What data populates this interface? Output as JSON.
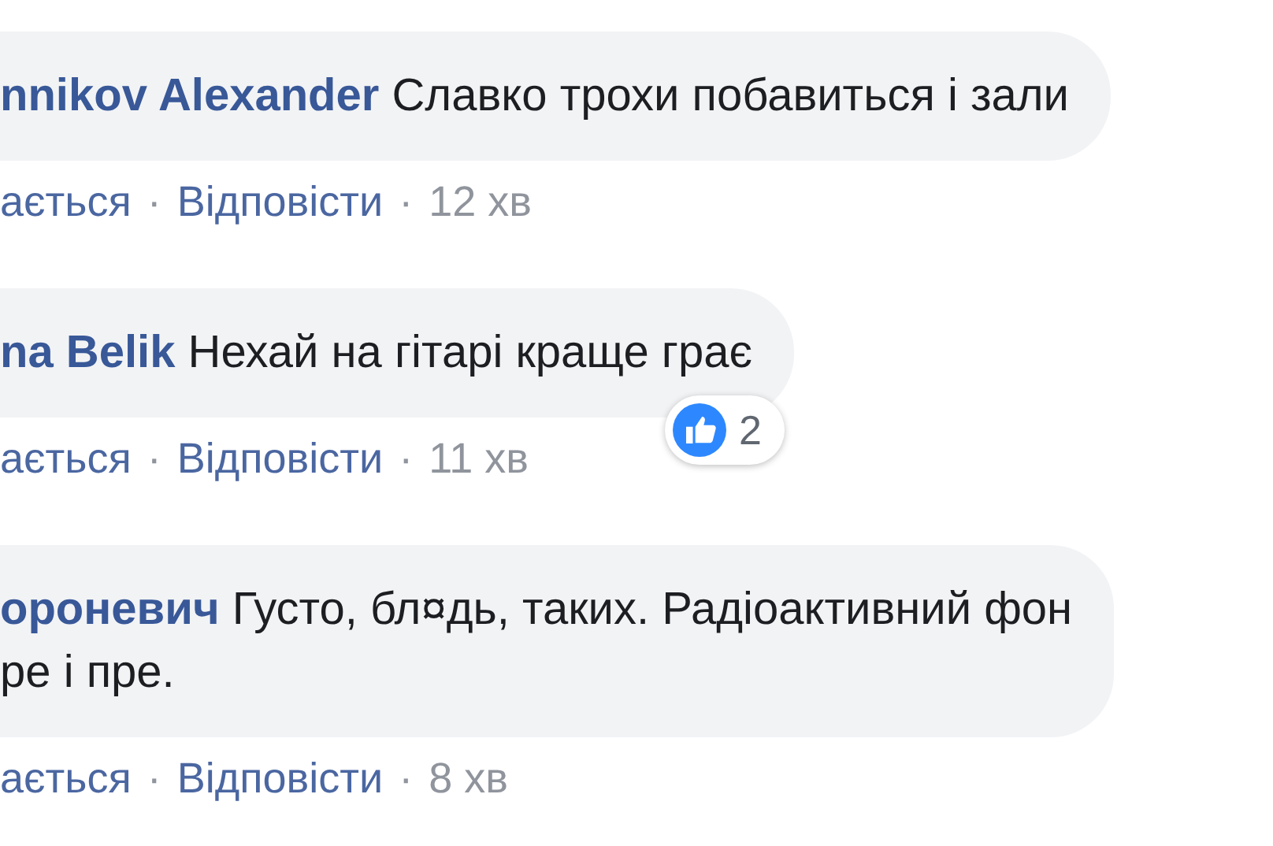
{
  "comments": [
    {
      "author": "nnikov Alexander",
      "text": "Славко трохи побавиться і зали",
      "actions": [
        {
          "kind": "link",
          "text": "ається"
        },
        {
          "kind": "separator",
          "text": "·"
        },
        {
          "kind": "link",
          "text": "Відповісти"
        },
        {
          "kind": "separator",
          "text": "·"
        },
        {
          "kind": "time",
          "text": "12 хв"
        }
      ]
    },
    {
      "author": "na Belik",
      "text": "Нехай на гітарі краще грає",
      "reactions": {
        "count": "2"
      },
      "actions": [
        {
          "kind": "link",
          "text": "ається"
        },
        {
          "kind": "separator",
          "text": "·"
        },
        {
          "kind": "link",
          "text": "Відповісти"
        },
        {
          "kind": "separator",
          "text": "·"
        },
        {
          "kind": "time",
          "text": "11 хв"
        }
      ]
    },
    {
      "author": "ороневич",
      "text": "Густо, бл¤дь, таких. Радіоактивний фон\nре і пре.",
      "actions": [
        {
          "kind": "link",
          "text": "ається"
        },
        {
          "kind": "separator",
          "text": "·"
        },
        {
          "kind": "link",
          "text": "Відповісти"
        },
        {
          "kind": "separator",
          "text": "·"
        },
        {
          "kind": "time",
          "text": "8 хв"
        }
      ]
    }
  ]
}
